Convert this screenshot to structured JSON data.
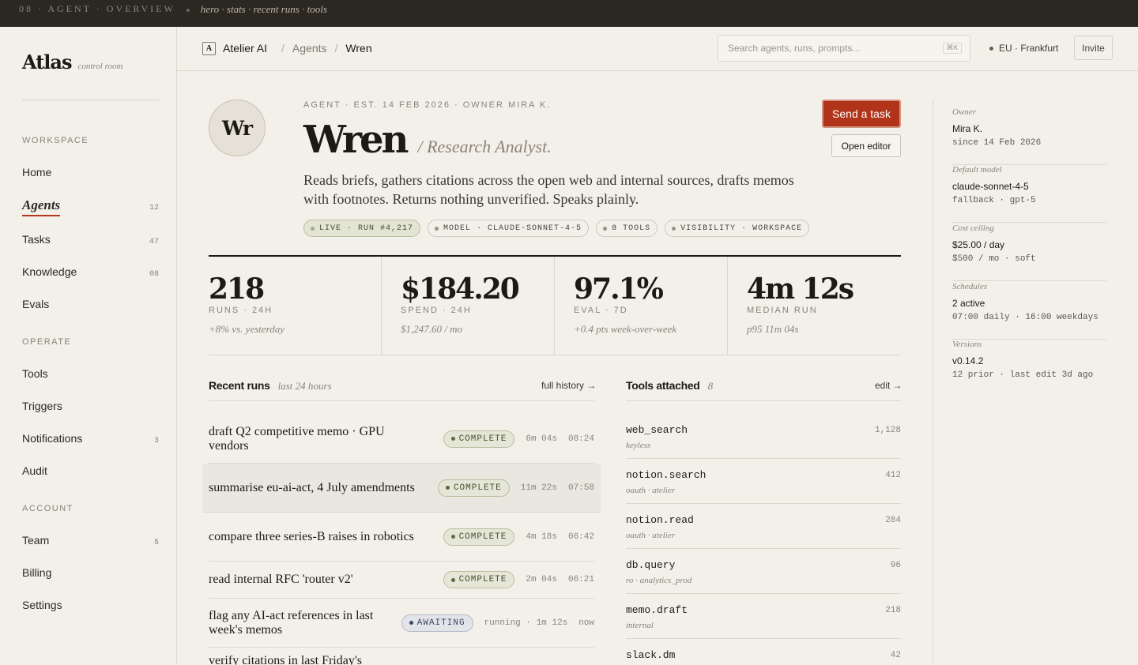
{
  "caption": {
    "number": "08 · AGENT · OVERVIEW",
    "description": "hero · stats · recent runs · tools"
  },
  "brand": {
    "name": "Atlas",
    "subtitle": "control room"
  },
  "nav": {
    "sections": [
      "WORKSPACE",
      "OPERATE",
      "ACCOUNT"
    ],
    "workspace": [
      {
        "label": "Home",
        "count": ""
      },
      {
        "label": "Agents",
        "count": "12"
      },
      {
        "label": "Tasks",
        "count": "47"
      },
      {
        "label": "Knowledge",
        "count": "08"
      },
      {
        "label": "Evals",
        "count": ""
      }
    ],
    "operate": [
      {
        "label": "Tools",
        "count": ""
      },
      {
        "label": "Triggers",
        "count": ""
      },
      {
        "label": "Notifications",
        "count": "3"
      },
      {
        "label": "Audit",
        "count": ""
      }
    ],
    "account": [
      {
        "label": "Team",
        "count": "5"
      },
      {
        "label": "Billing",
        "count": ""
      },
      {
        "label": "Settings",
        "count": ""
      }
    ]
  },
  "topbar": {
    "workspace_badge": "A",
    "workspace_name": "Atelier AI",
    "crumb_agents": "Agents",
    "crumb_current": "Wren",
    "search_placeholder": "Search agents, runs, prompts...",
    "search_shortcut": "⌘K",
    "region": "EU · Frankfurt",
    "invite_label": "Invite"
  },
  "agent": {
    "initials": "Wr",
    "eyebrow": "AGENT · EST. 14 FEB 2026 · OWNER MIRA K.",
    "name": "Wren",
    "role": "/ Research Analyst.",
    "description": "Reads briefs, gathers citations across the open web and internal sources, drafts memos with footnotes. Returns nothing unverified. Speaks plainly.",
    "chips": [
      "LIVE · RUN #4,217",
      "MODEL · CLAUDE-SONNET-4-5",
      "8 TOOLS",
      "VISIBILITY · WORKSPACE"
    ],
    "primary_action": "Send a task",
    "secondary_action": "Open editor"
  },
  "stats": [
    {
      "value": "218",
      "label": "RUNS · 24H",
      "sub": "+8% vs. yesterday"
    },
    {
      "value": "$184.20",
      "label": "SPEND · 24H",
      "sub": "$1,247.60 / mo"
    },
    {
      "value": "97.1%",
      "label": "EVAL · 7D",
      "sub": "+0.4 pts week-over-week"
    },
    {
      "value": "4m 12s",
      "label": "MEDIAN RUN",
      "sub": "p95 11m 04s"
    }
  ],
  "recent_runs": {
    "title": "Recent runs",
    "subtitle": "last 24 hours",
    "link": "full history →",
    "rows": [
      {
        "title": "draft Q2 competitive memo · GPU vendors",
        "status": "COMPLETE",
        "duration": "6m 04s",
        "time": "08:24"
      },
      {
        "title": "summarise eu-ai-act, 4 July amendments",
        "status": "COMPLETE",
        "duration": "11m 22s",
        "time": "07:58"
      },
      {
        "title": "compare three series-B raises in robotics",
        "status": "COMPLETE",
        "duration": "4m 18s",
        "time": "06:42"
      },
      {
        "title": "read internal RFC 'router v2'",
        "status": "COMPLETE",
        "duration": "2m 04s",
        "time": "06:21"
      },
      {
        "title": "flag any AI-act references in last week's memos",
        "status": "AWAITING",
        "duration": "running · 1m 12s",
        "time": "now"
      },
      {
        "title": "verify citations in last Friday's",
        "status": "",
        "duration": "",
        "time": ""
      }
    ]
  },
  "tools": {
    "title": "Tools attached",
    "count": "8",
    "link": "edit →",
    "rows": [
      {
        "name": "web_search",
        "meta": "keyless",
        "count": "1,128"
      },
      {
        "name": "notion.search",
        "meta": "oauth · atelier",
        "count": "412"
      },
      {
        "name": "notion.read",
        "meta": "oauth · atelier",
        "count": "284"
      },
      {
        "name": "db.query",
        "meta": "ro · analytics_prod",
        "count": "96"
      },
      {
        "name": "memo.draft",
        "meta": "internal",
        "count": "218"
      },
      {
        "name": "slack.dm",
        "meta": "",
        "count": "42"
      }
    ]
  },
  "rail": [
    {
      "label": "Owner",
      "value": "Mira K.",
      "sub": "since 14 Feb 2026"
    },
    {
      "label": "Default model",
      "value": "claude-sonnet-4-5",
      "sub": "fallback · gpt-5"
    },
    {
      "label": "Cost ceiling",
      "value": "$25.00 / day",
      "sub": "$500 / mo · soft"
    },
    {
      "label": "Schedules",
      "value": "2 active",
      "sub": "07:00 daily · 16:00 weekdays"
    },
    {
      "label": "Versions",
      "value": "v0.14.2",
      "sub": "12 prior · last edit 3d ago"
    }
  ],
  "colors": {
    "accent": "#b1341a",
    "background": "#f3f0ea",
    "ink": "#1d1a16",
    "muted": "#8a8378",
    "complete": "#45522c",
    "awaiting": "#3c4664"
  }
}
